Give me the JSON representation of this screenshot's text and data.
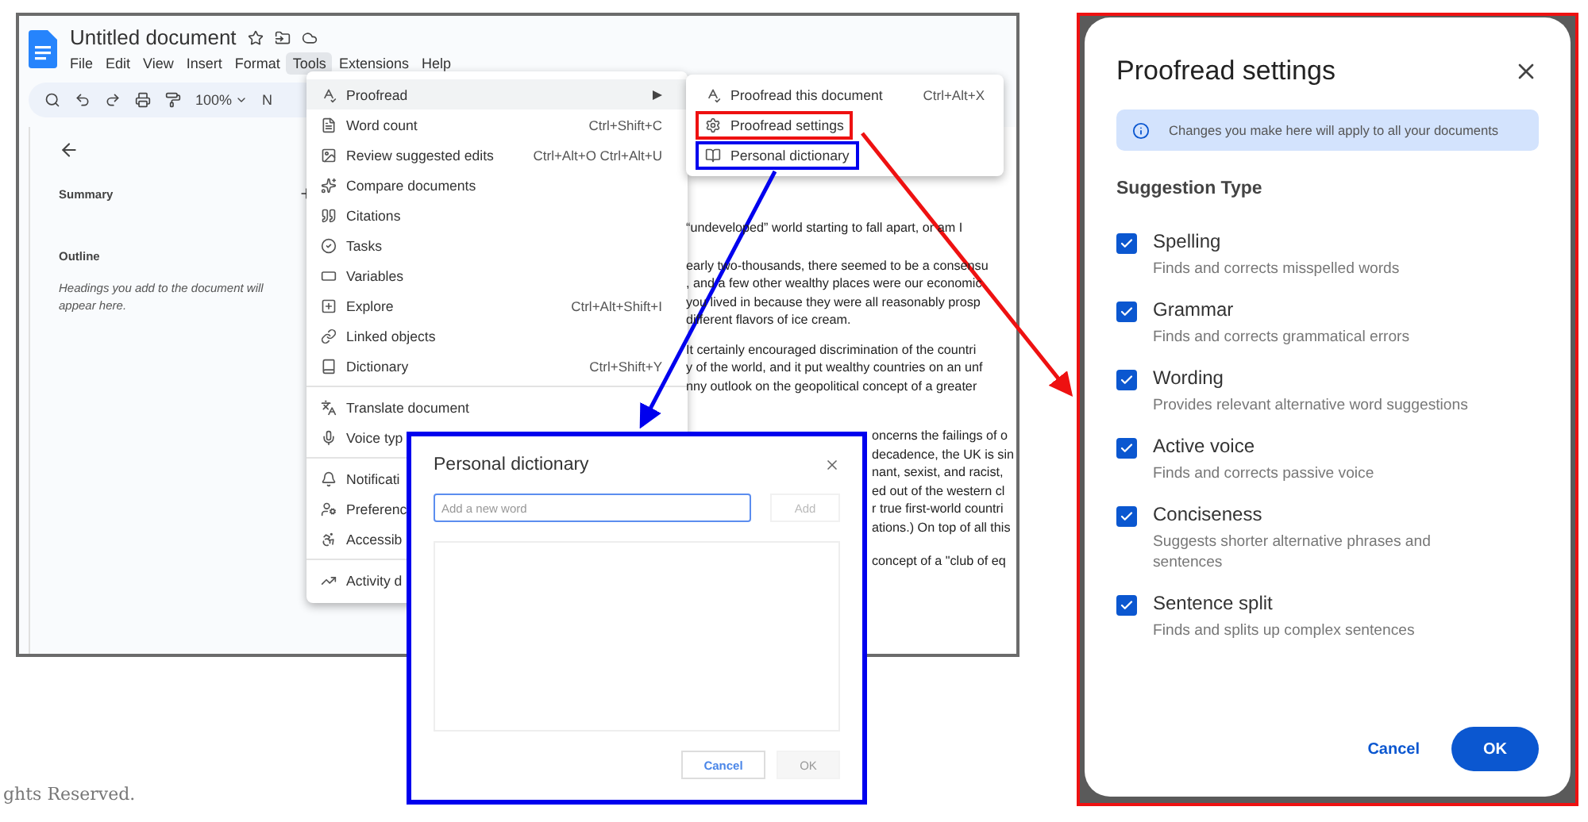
{
  "docs_window": {
    "title": "Untitled document",
    "menubar": [
      {
        "label": "File",
        "selected": false
      },
      {
        "label": "Edit",
        "selected": false
      },
      {
        "label": "View",
        "selected": false
      },
      {
        "label": "Insert",
        "selected": false
      },
      {
        "label": "Format",
        "selected": false
      },
      {
        "label": "Tools",
        "selected": true
      },
      {
        "label": "Extensions",
        "selected": false
      },
      {
        "label": "Help",
        "selected": false
      }
    ],
    "toolbar": {
      "zoom": "100%",
      "style_fragment": "N"
    },
    "sidebar": {
      "summary": "Summary",
      "outline": "Outline",
      "outline_hint": "Headings you add to the document will appear here."
    },
    "document_paragraphs": [
      [
        "“undeveloped” world starting to fall apart, or am I"
      ],
      [
        "early two-thousands, there seemed to be a consensu",
        ", and a few other wealthy places were our economic",
        "you lived in because they were all reasonably prosp",
        "different flavors of ice cream."
      ],
      [
        "It certainly encouraged discrimination of the countri",
        "y of the world, and it put wealthy countries on an unf",
        "nny outlook on the geopolitical concept of a greater"
      ],
      [
        "oncerns the failings of o",
        "decadence, the UK is sin",
        "nant, sexist, and racist,",
        "ed out of the western cl",
        "r true first-world countri",
        "ations.) On top of all this"
      ],
      [
        "concept of a \"club of eq"
      ]
    ],
    "tools_menu": {
      "groups": [
        [
          {
            "label": "Proofread",
            "has_submenu": true,
            "selected": true
          },
          {
            "label": "Word count",
            "shortcut": "Ctrl+Shift+C",
            "has_submenu": false,
            "selected": false
          },
          {
            "label": "Review suggested edits",
            "shortcut": "Ctrl+Alt+O Ctrl+Alt+U",
            "has_submenu": false,
            "selected": false
          },
          {
            "label": "Compare documents",
            "has_submenu": false,
            "selected": false
          },
          {
            "label": "Citations",
            "has_submenu": false,
            "selected": false
          },
          {
            "label": "Tasks",
            "has_submenu": false,
            "selected": false
          },
          {
            "label": "Variables",
            "has_submenu": false,
            "selected": false
          },
          {
            "label": "Explore",
            "shortcut": "Ctrl+Alt+Shift+I",
            "has_submenu": false,
            "selected": false
          },
          {
            "label": "Linked objects",
            "has_submenu": false,
            "selected": false
          },
          {
            "label": "Dictionary",
            "shortcut": "Ctrl+Shift+Y",
            "has_submenu": false,
            "selected": false
          }
        ],
        [
          {
            "label": "Translate document",
            "has_submenu": false,
            "selected": false
          },
          {
            "label": "Voice typ",
            "has_submenu": false,
            "selected": false
          }
        ],
        [
          {
            "label": "Notificati",
            "has_submenu": false,
            "selected": false
          },
          {
            "label": "Preferenc",
            "has_submenu": false,
            "selected": false
          },
          {
            "label": "Accessib",
            "has_submenu": false,
            "selected": false
          }
        ],
        [
          {
            "label": "Activity d",
            "has_submenu": false,
            "selected": false
          }
        ]
      ]
    },
    "proofread_submenu": [
      {
        "label": "Proofread this document",
        "shortcut": "Ctrl+Alt+X"
      },
      {
        "label": "Proofread settings",
        "color": "#ee1111"
      },
      {
        "label": "Personal dictionary",
        "color": "#0000ee"
      }
    ]
  },
  "personal_dictionary_dialog": {
    "title": "Personal dictionary",
    "input": {
      "placeholder": "Add a new word"
    },
    "add_button": {
      "label": "Add",
      "disabled": true
    },
    "buttons": [
      {
        "label": "Cancel",
        "kind": "secondary"
      },
      {
        "label": "OK",
        "kind": "disabled"
      }
    ]
  },
  "proofread_settings_dialog": {
    "title": "Proofread settings",
    "info": "Changes you make here will apply to all your documents",
    "section_title": "Suggestion Type",
    "options": [
      {
        "label": "Spelling",
        "description": "Finds and corrects misspelled words",
        "checked": true
      },
      {
        "label": "Grammar",
        "description": "Finds and corrects grammatical errors",
        "checked": true
      },
      {
        "label": "Wording",
        "description": "Provides relevant alternative word suggestions",
        "checked": true
      },
      {
        "label": "Active voice",
        "description": "Finds and corrects passive voice",
        "checked": true
      },
      {
        "label": "Conciseness",
        "description": "Suggests shorter alternative phrases and sentences",
        "checked": true
      },
      {
        "label": "Sentence split",
        "description": "Finds and splits up complex sentences",
        "checked": true
      }
    ],
    "buttons": [
      {
        "label": "Cancel",
        "kind": "text"
      },
      {
        "label": "OK",
        "kind": "primary"
      }
    ]
  },
  "footer": "ghts Reserved."
}
